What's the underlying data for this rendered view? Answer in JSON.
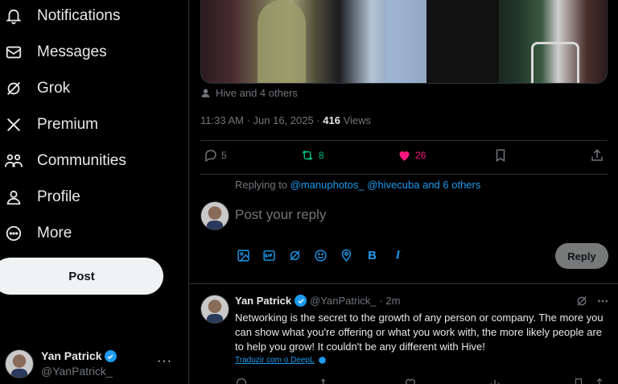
{
  "sidebar": {
    "items": [
      {
        "label": "Notifications",
        "icon": "bell-icon"
      },
      {
        "label": "Messages",
        "icon": "envelope-icon"
      },
      {
        "label": "Grok",
        "icon": "grok-icon"
      },
      {
        "label": "Premium",
        "icon": "x-logo-icon"
      },
      {
        "label": "Communities",
        "icon": "people-icon"
      },
      {
        "label": "Profile",
        "icon": "person-icon"
      },
      {
        "label": "More",
        "icon": "more-circle-icon"
      }
    ],
    "post_label": "Post",
    "account": {
      "display_name": "Yan Patrick",
      "handle": "@YanPatrick_",
      "more": "···"
    }
  },
  "tweet": {
    "retweeted_by": "Hive and 4 others",
    "time": "11:33 AM · Jun 16, 2025 · ",
    "views_count": "416",
    "views_label": " Views",
    "actions": {
      "replies": "5",
      "reposts": "8",
      "likes": "26"
    }
  },
  "compose": {
    "replying_prefix": "Replying to ",
    "replying_to": "@manuphotos_ @hivecuba and 6 others",
    "placeholder": "Post your reply",
    "reply_label": "Reply",
    "tools": [
      "image-icon",
      "gif-icon",
      "grok-icon",
      "emoji-icon",
      "location-icon",
      "bold-icon",
      "italic-icon"
    ],
    "bold_glyph": "B",
    "italic_glyph": "I"
  },
  "reply_tweet": {
    "display_name": "Yan Patrick",
    "handle": "@YanPatrick_",
    "time": "· 2m",
    "body": "Networking is the secret to the growth of any person or company. The more you can show what you're offering or what you work with, the more likely people are to help you grow! It couldn't be any different with Hive!",
    "translate": "Traduzir com o DeepL"
  },
  "colors": {
    "accent": "#1d9bf0",
    "repost": "#00ba7c",
    "like": "#f91880",
    "muted": "#71767b"
  }
}
